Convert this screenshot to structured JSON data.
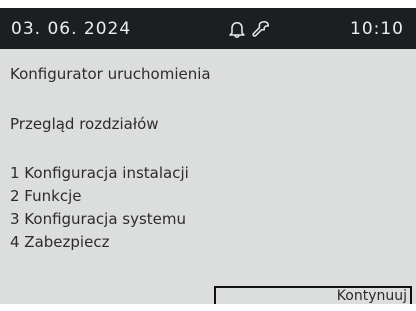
{
  "status_bar": {
    "date": "03. 06. 2024",
    "time": "10:10",
    "icons": [
      "bell-icon",
      "wrench-icon"
    ]
  },
  "screen": {
    "title": "Konfigurator uruchomienia",
    "subtitle": "Przegląd rozdziałów",
    "items": [
      "1 Konfiguracja instalacji",
      "2 Funkcje",
      "3 Konfiguracja systemu",
      "4 Zabezpiecz"
    ],
    "button_label": "Kontynuuj"
  },
  "colors": {
    "status_bar_bg": "#1c1f22",
    "screen_bg": "#dcdedd",
    "text": "#2c2c2c"
  }
}
